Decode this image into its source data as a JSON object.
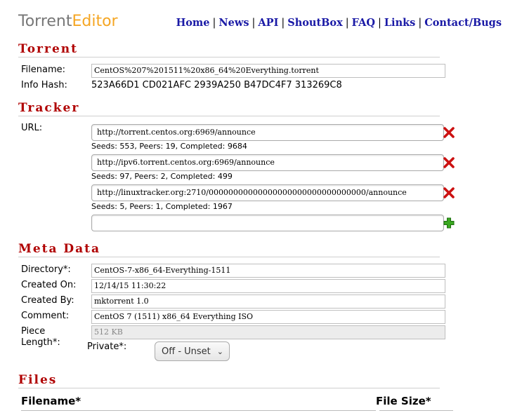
{
  "logo": {
    "part1": "Torrent",
    "part2": "Editor"
  },
  "nav": [
    "Home",
    "News",
    "API",
    "ShoutBox",
    "FAQ",
    "Links",
    "Contact/Bugs"
  ],
  "nav_separator": "|",
  "sections": {
    "torrent": "Torrent",
    "tracker": "Tracker",
    "meta": "Meta Data",
    "files": "Files"
  },
  "torrent": {
    "filename_label": "Filename:",
    "filename_value": "CentOS%207%201511%20x86_64%20Everything.torrent",
    "infohash_label": "Info Hash:",
    "infohash_value": "523A66D1 CD021AFC 2939A250 B47DC4F7 313269C8"
  },
  "tracker": {
    "url_label": "URL:",
    "items": [
      {
        "url": "http://torrent.centos.org:6969/announce",
        "stats": "Seeds: 553, Peers: 19, Completed: 9684"
      },
      {
        "url": "http://ipv6.torrent.centos.org:6969/announce",
        "stats": "Seeds: 97, Peers: 2, Completed: 499"
      },
      {
        "url": "http://linuxtracker.org:2710/00000000000000000000000000000000/announce",
        "stats": "Seeds: 5, Peers: 1, Completed: 1967"
      }
    ],
    "new_url_value": ""
  },
  "meta": {
    "directory_label": "Directory*:",
    "directory_value": "CentOS-7-x86_64-Everything-1511",
    "created_on_label": "Created On:",
    "created_on_value": "12/14/15 11:30:22",
    "created_by_label": "Created By:",
    "created_by_value": "mktorrent 1.0",
    "comment_label": "Comment:",
    "comment_value": "CentOS 7 (1511) x86_64 Everything ISO",
    "piece_label_1": "Piece",
    "piece_label_2": "Length*:",
    "piece_value": "512 KB",
    "private_label": "Private*:",
    "private_value": "Off - Unset"
  },
  "files": {
    "col_filename": "Filename*",
    "col_size": "File Size*"
  },
  "icons": {
    "remove": "remove-x-icon",
    "add": "add-plus-icon",
    "dropdown": "chevron-down-icon"
  },
  "colors": {
    "accent": "#b00000",
    "nav_link": "#1a1aa6",
    "logo_gray": "#777777",
    "logo_orange": "#f5a623",
    "remove_red": "#cc1111",
    "add_green": "#3aa820"
  }
}
